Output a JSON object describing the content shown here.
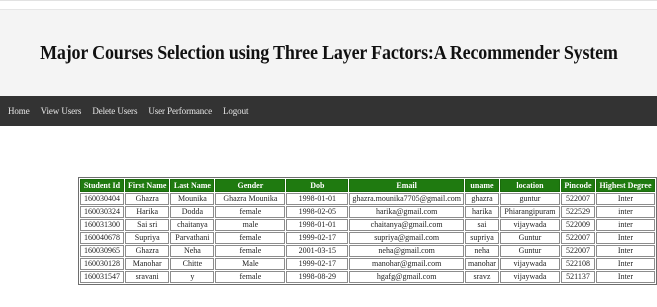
{
  "page": {
    "title": "Major Courses Selection using Three Layer Factors:A Recommender System"
  },
  "nav": {
    "items": [
      "Home",
      "View Users",
      "Delete Users",
      "User Performance",
      "Logout"
    ]
  },
  "table": {
    "headers": [
      "Student Id",
      "First Name",
      "Last Name",
      "Gender",
      "Dob",
      "Email",
      "uname",
      "location",
      "Pincode",
      "Highest Degree"
    ],
    "rows": [
      [
        "160030404",
        "Ghazra",
        "Mounika",
        "Ghazra Mounika",
        "1998-01-01",
        "ghazra.mounika7705@gmail.com",
        "ghazra",
        "guntur",
        "522007",
        "Inter"
      ],
      [
        "160030324",
        "Harika",
        "Dodda",
        "female",
        "1998-02-05",
        "harika@gmail.com",
        "harika",
        "Phiarangipuram",
        "522529",
        "inter"
      ],
      [
        "160031300",
        "Sai sri",
        "chaitanya",
        "male",
        "1998-01-01",
        "chaitanya@gmail.com",
        "sai",
        "vijaywada",
        "522009",
        "inter"
      ],
      [
        "160040678",
        "Supriya",
        "Parvathani",
        "female",
        "1999-02-17",
        "supriya@gmail.com",
        "supriya",
        "Guntur",
        "522007",
        "Inter"
      ],
      [
        "160030965",
        "Ghazra",
        "Neha",
        "female",
        "2001-03-15",
        "neha@gmail.com",
        "neha",
        "Guntur",
        "522007",
        "Inter"
      ],
      [
        "160030128",
        "Manohar",
        "Chitte",
        "Male",
        "1999-02-17",
        "manohar@gmail.com",
        "manohar",
        "vijaywada",
        "522108",
        "Inter"
      ],
      [
        "160031547",
        "sravani",
        "y",
        "female",
        "1998-08-29",
        "hgafg@gmail.com",
        "sravz",
        "vijaywada",
        "521137",
        "Inter"
      ]
    ]
  },
  "colors": {
    "header_bg": "#1f7a10",
    "navbar_bg": "#333333",
    "banner_bg": "#f4f4f4"
  }
}
